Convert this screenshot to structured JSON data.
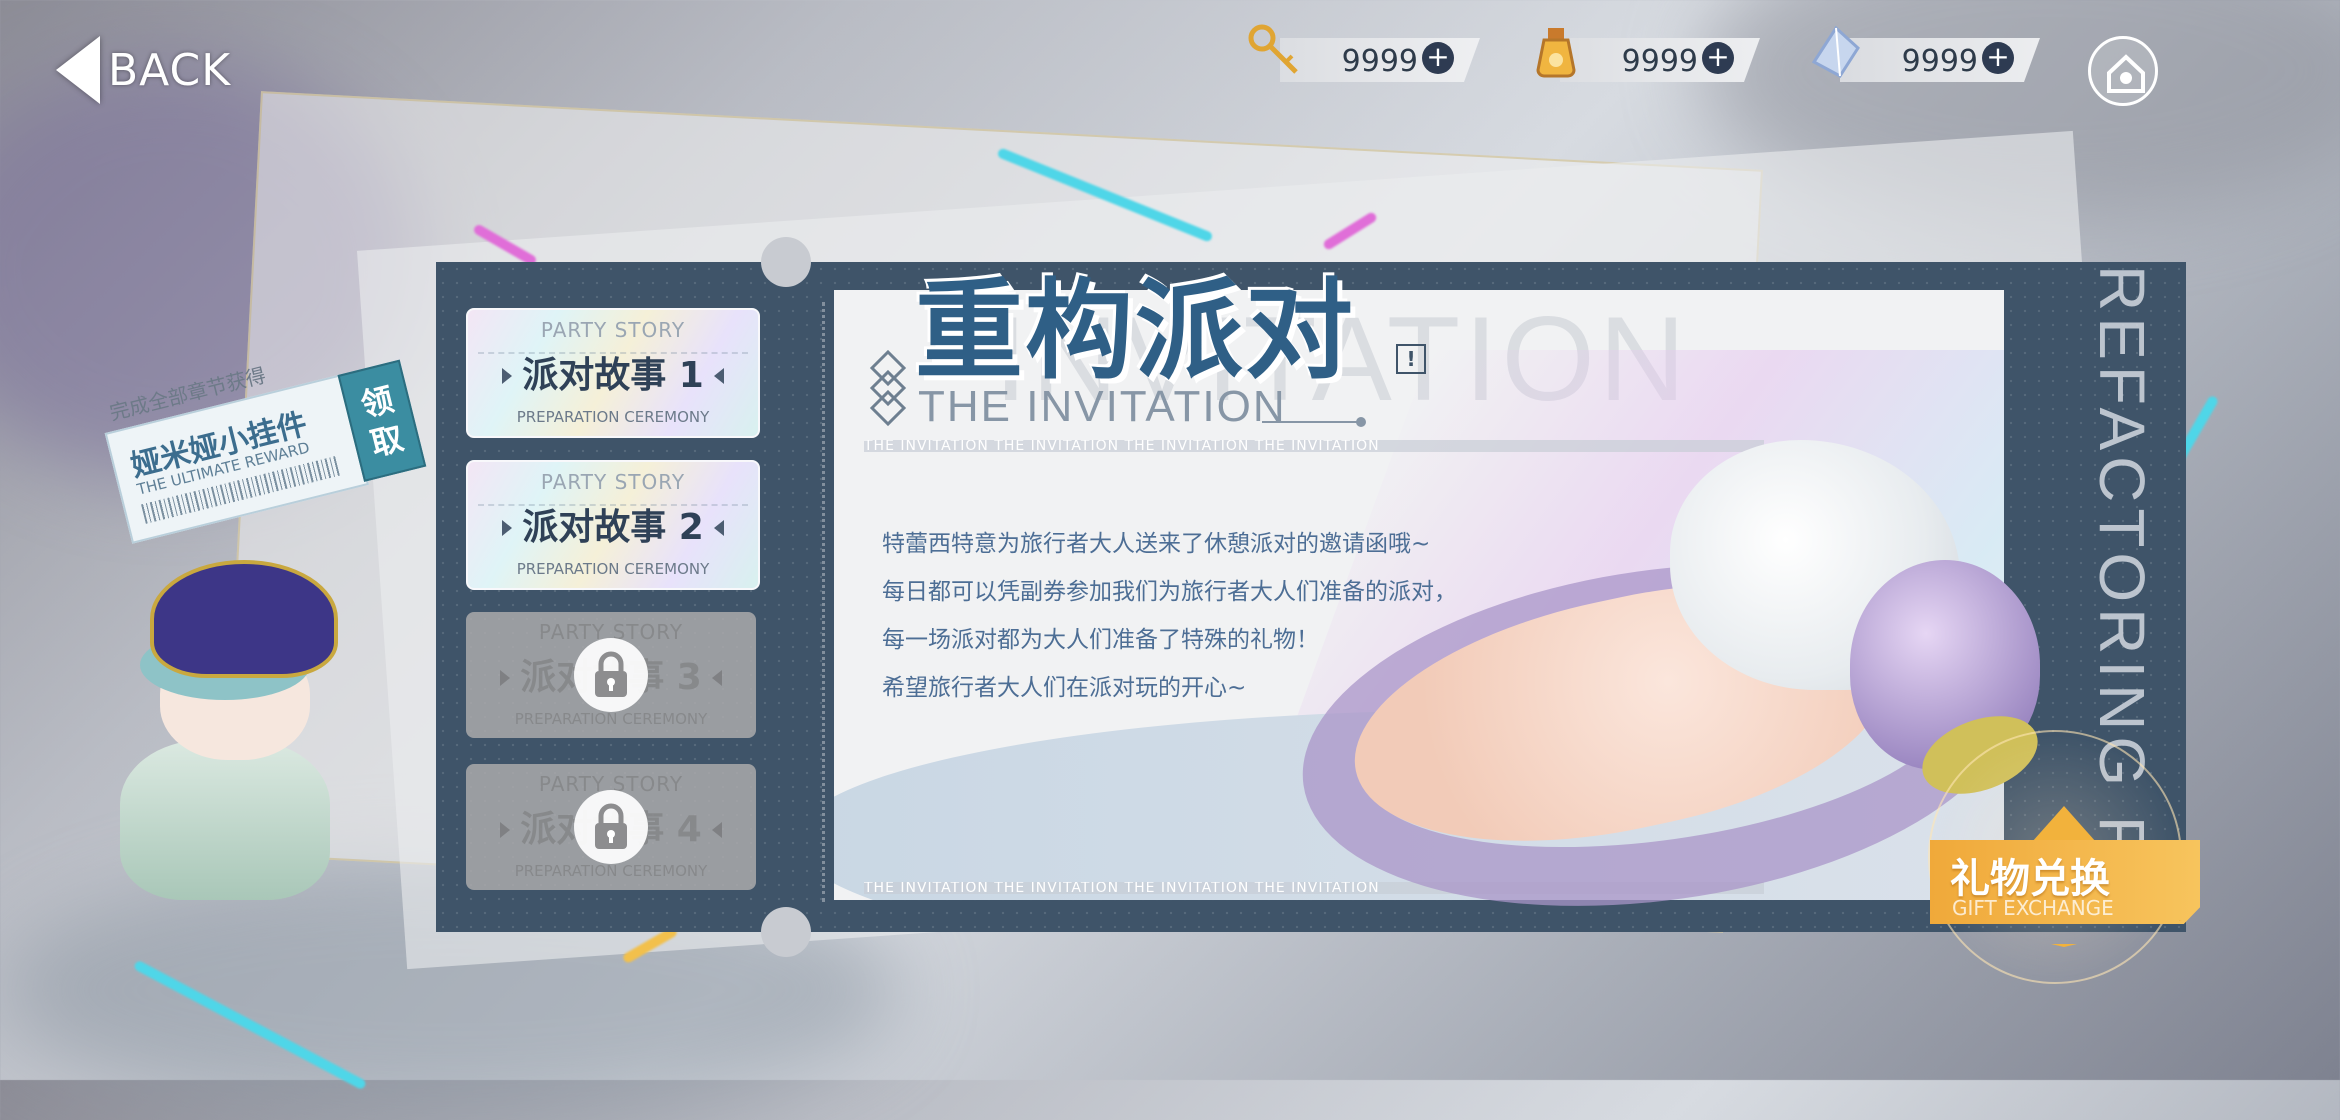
{
  "topbar": {
    "back_label": "BACK",
    "currencies": [
      {
        "icon": "key-icon",
        "value": "9999",
        "plus": "+"
      },
      {
        "icon": "potion-icon",
        "value": "9999",
        "plus": "+"
      },
      {
        "icon": "crystal-icon",
        "value": "9999",
        "plus": "+"
      }
    ]
  },
  "reward": {
    "top_text": "完成全部章节获得",
    "name": "娅米娅小挂件",
    "subtitle": "THE ULTIMATE REWARD",
    "claim_label": "领取"
  },
  "stories": [
    {
      "header": "PARTY STORY",
      "title": "派对故事 1",
      "subtitle": "PREPARATION CEREMONY",
      "locked": false
    },
    {
      "header": "PARTY STORY",
      "title": "派对故事 2",
      "subtitle": "PREPARATION CEREMONY",
      "locked": false
    },
    {
      "header": "PARTY STORY",
      "title": "派对故事 3",
      "subtitle": "PREPARATION CEREMONY",
      "locked": true
    },
    {
      "header": "PARTY STORY",
      "title": "派对故事 4",
      "subtitle": "PREPARATION CEREMONY",
      "locked": true
    }
  ],
  "invitation": {
    "title_cn": "重构派对",
    "title_en": "THE INVITATION",
    "background_word": "INVITATION",
    "strip_text": "THE INVITATION THE INVITATION THE INVITATION THE INVITATION",
    "info_icon": "!",
    "description": [
      "特蕾西特意为旅行者大人送来了休憩派对的邀请函哦~",
      "每日都可以凭副券参加我们为旅行者大人们准备的派对，",
      "每一场派对都为大人们准备了特殊的礼物！",
      "希望旅行者大人们在派对玩的开心~"
    ],
    "vertical_text": "REFACTORING PA"
  },
  "gift_exchange": {
    "label_cn": "礼物兑换",
    "label_en": "GIFT EXCHANGE"
  }
}
